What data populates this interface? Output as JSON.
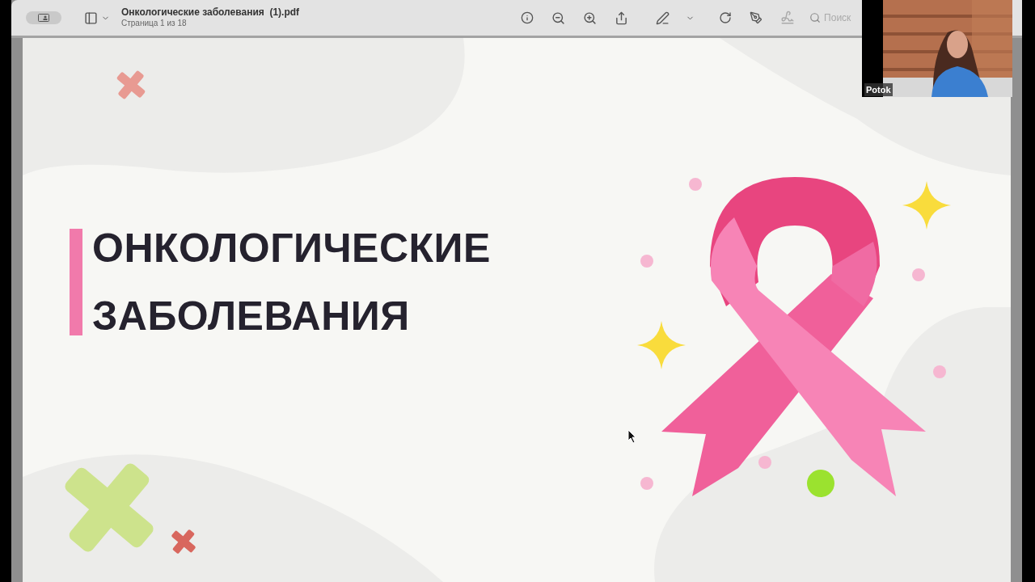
{
  "toolbar": {
    "title": "Онкологические заболевания  (1).pdf",
    "subtitle": "Страница 1 из 18",
    "search": {
      "placeholder": "Поиск"
    }
  },
  "slide": {
    "title_lines": [
      "ОНКОЛОГИЧЕСКИЕ",
      "ЗАБОЛЕВАНИЯ"
    ]
  },
  "video": {
    "name": "Potok"
  }
}
